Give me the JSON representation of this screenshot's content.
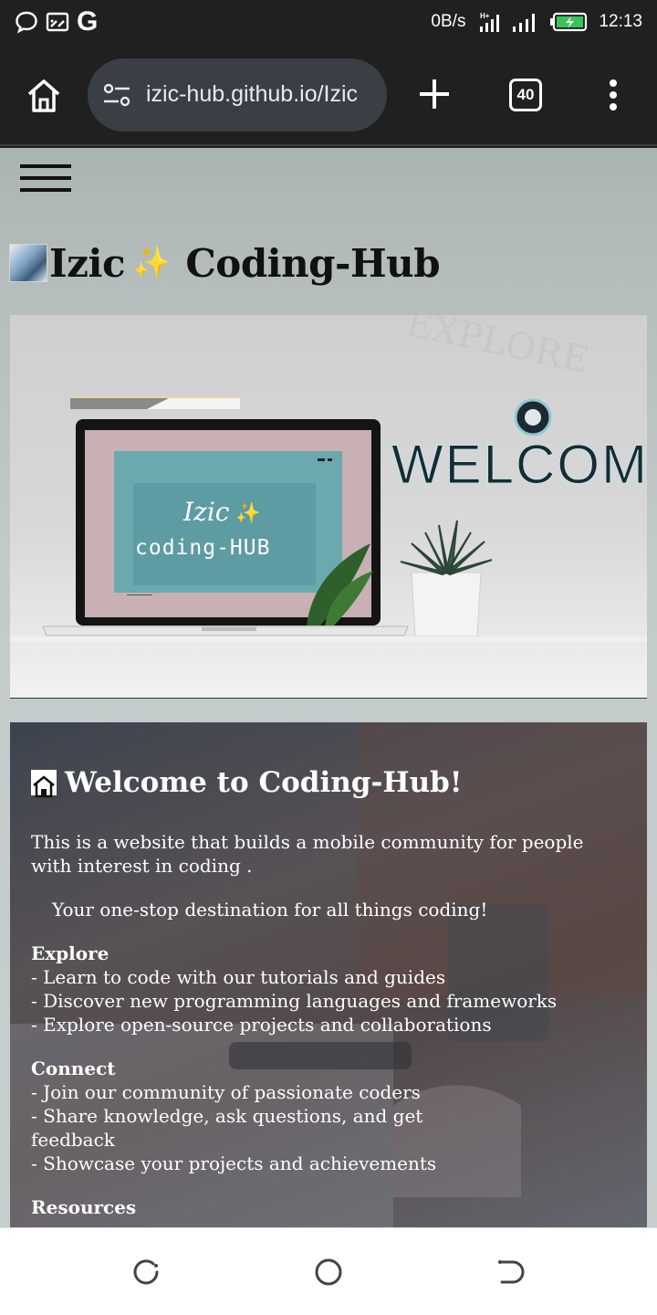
{
  "status_bar": {
    "net_speed": "0B/s",
    "time": "12:13",
    "google_letter": "G"
  },
  "browser": {
    "url": "izic-hub.github.io/Izic",
    "tab_count": "40"
  },
  "site": {
    "title_left": "Izic",
    "title_sparkle": "✨",
    "title_right": "Coding-Hub"
  },
  "banner": {
    "screen_line1": "Izic",
    "screen_sparkle": "✨",
    "screen_line2": "coding-HUB",
    "welcome": "WELCOM",
    "watermark": "EXPLORE"
  },
  "card": {
    "heading": "Welcome to Coding-Hub!",
    "intro": "This is a website that builds a mobile community for people with interest in coding .",
    "tagline": "Your one-stop destination for all things coding!",
    "sections": [
      {
        "title": "Explore",
        "items": [
          "- Learn to code with our tutorials and guides",
          "- Discover new programming languages and frameworks",
          "- Explore open-source projects and collaborations"
        ]
      },
      {
        "title": "Connect",
        "items": [
          "- Join our community of passionate coders",
          "- Share knowledge, ask questions, and get feedback",
          "- Showcase your projects and achievements"
        ]
      },
      {
        "title": "Resources",
        "items": []
      }
    ]
  },
  "colors": {
    "chrome_dark": "#202020",
    "url_pill": "#3a3f45",
    "page_bg": "#c3cbca",
    "sparkle": "#f2c21b",
    "welcome_text": "#1a2a30"
  }
}
